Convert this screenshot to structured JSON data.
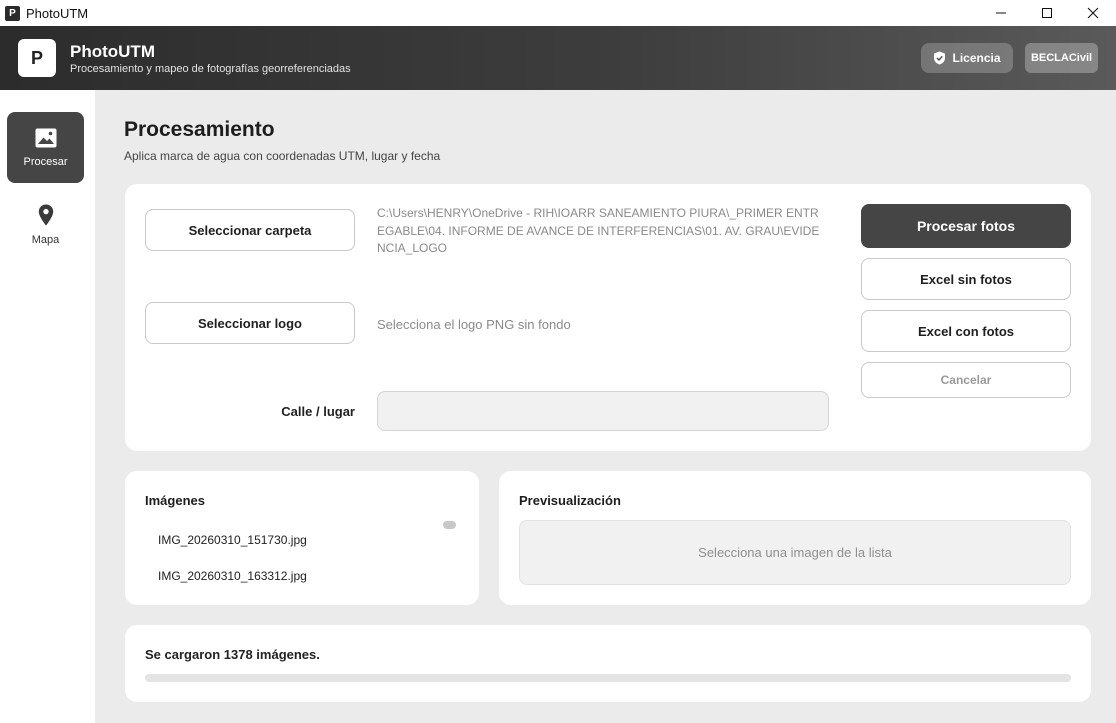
{
  "window": {
    "title": "PhotoUTM",
    "app_icon_letter": "P"
  },
  "header": {
    "logo_letter": "P",
    "app_name": "PhotoUTM",
    "subtitle": "Procesamiento y mapeo de fotografías georreferenciadas",
    "license_label": "Licencia",
    "user_label": "BECLACivil"
  },
  "sidebar": {
    "items": [
      {
        "label": "Procesar",
        "icon": "image-icon",
        "active": true
      },
      {
        "label": "Mapa",
        "icon": "map-pin-icon",
        "active": false
      }
    ]
  },
  "main": {
    "title": "Procesamiento",
    "subtitle": "Aplica marca de agua con coordenadas UTM, lugar y fecha"
  },
  "inputs": {
    "select_folder_label": "Seleccionar carpeta",
    "folder_path": "C:\\Users\\HENRY\\OneDrive - RIH\\IOARR SANEAMIENTO PIURA\\_PRIMER ENTREGABLE\\04. INFORME DE AVANCE DE INTERFERENCIAS\\01. AV. GRAU\\EVIDENCIA_LOGO",
    "select_logo_label": "Seleccionar logo",
    "logo_hint": "Selecciona el logo PNG sin fondo",
    "street_label": "Calle / lugar",
    "street_value": ""
  },
  "actions": {
    "process_label": "Procesar fotos",
    "excel_no_photos_label": "Excel sin fotos",
    "excel_with_photos_label": "Excel con fotos",
    "cancel_label": "Cancelar"
  },
  "images_panel": {
    "title": "Imágenes",
    "files": [
      "IMG_20260310_151730.jpg",
      "IMG_20260310_163312.jpg"
    ]
  },
  "preview_panel": {
    "title": "Previsualización",
    "placeholder": "Selecciona una imagen de la lista"
  },
  "status": {
    "message": "Se cargaron 1378 imágenes.",
    "progress_percent": 0
  },
  "colors": {
    "primary": "#454545",
    "background": "#ebebeb",
    "card": "#ffffff"
  }
}
